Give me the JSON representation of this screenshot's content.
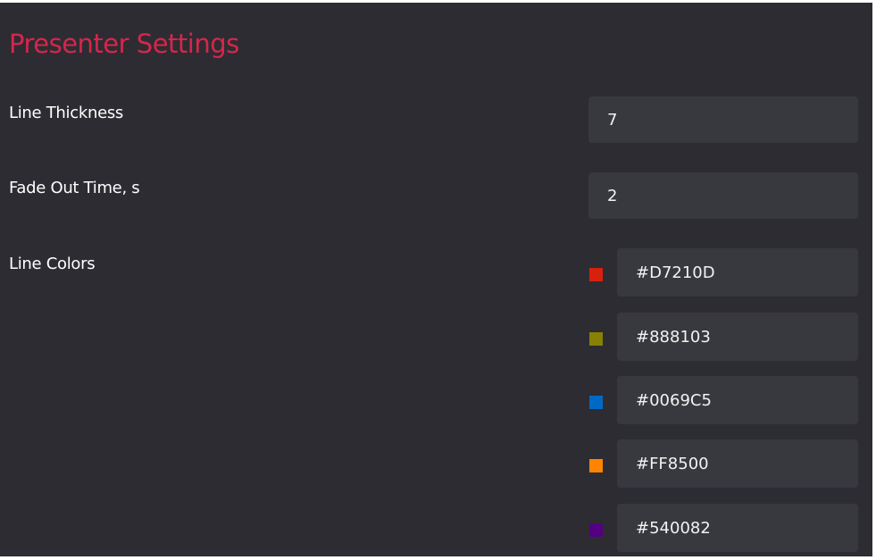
{
  "title": "Presenter Settings",
  "line_thickness": {
    "label": "Line Thickness",
    "value": "7"
  },
  "fade_out_time": {
    "label": "Fade Out Time, s",
    "value": "2"
  },
  "line_colors": {
    "label": "Line Colors",
    "items": [
      {
        "value": "#D7210D",
        "swatch": "#D7210D"
      },
      {
        "value": "#888103",
        "swatch": "#888103"
      },
      {
        "value": "#0069C5",
        "swatch": "#0069C5"
      },
      {
        "value": "#FF8500",
        "swatch": "#FF8500"
      },
      {
        "value": "#540082",
        "swatch": "#540082"
      }
    ]
  }
}
